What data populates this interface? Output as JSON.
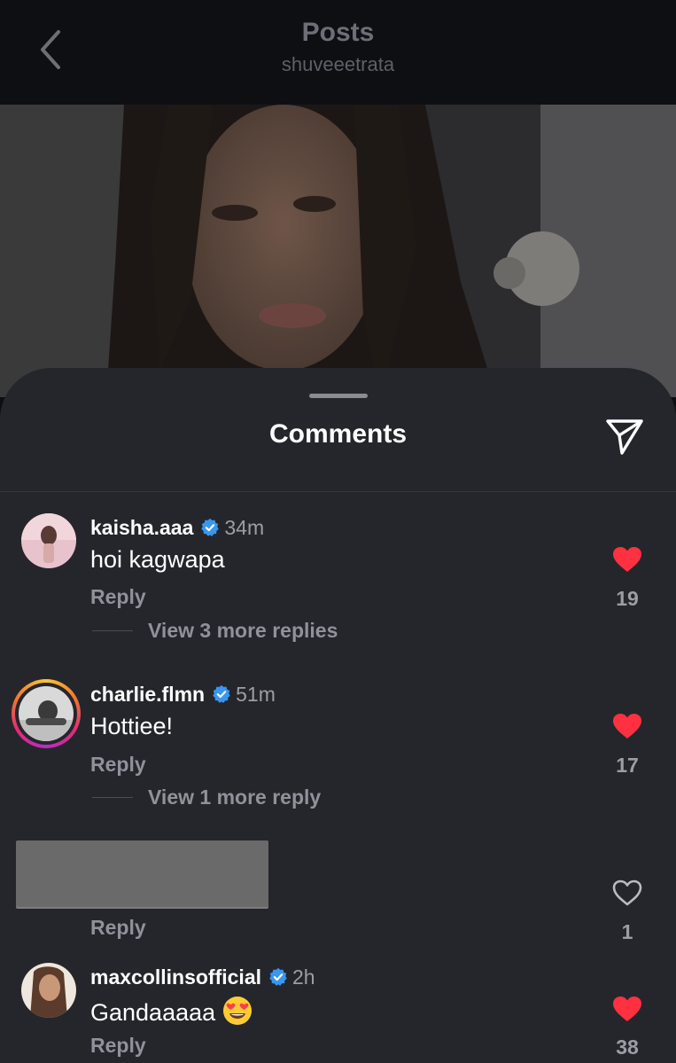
{
  "header": {
    "title": "Posts",
    "subtitle": "shuveeetrata",
    "back_icon": "chevron-left-icon"
  },
  "sheet": {
    "title": "Comments",
    "share_icon": "send-icon"
  },
  "colors": {
    "liked": "#ff3040",
    "verified": "#3897f0",
    "sheet_bg": "#25262b"
  },
  "comments": [
    {
      "username": "kaisha.aaa",
      "verified": true,
      "time": "34m",
      "text": "hoi kagwapa",
      "reply_label": "Reply",
      "view_replies": "View 3 more replies",
      "likes": "19",
      "liked": true
    },
    {
      "username": "charlie.flmn",
      "verified": true,
      "time": "51m",
      "text": "Hottiee!",
      "reply_label": "Reply",
      "view_replies": "View 1 more reply",
      "likes": "17",
      "liked": true,
      "has_story_ring": true
    },
    {
      "redacted": true,
      "reply_label": "Reply",
      "likes": "1",
      "liked": false
    },
    {
      "username": "maxcollinsofficial",
      "verified": true,
      "time": "2h",
      "text": "Gandaaaaa",
      "emoji": "heart-eyes-emoji",
      "reply_label": "Reply",
      "likes": "38",
      "liked": true
    }
  ]
}
